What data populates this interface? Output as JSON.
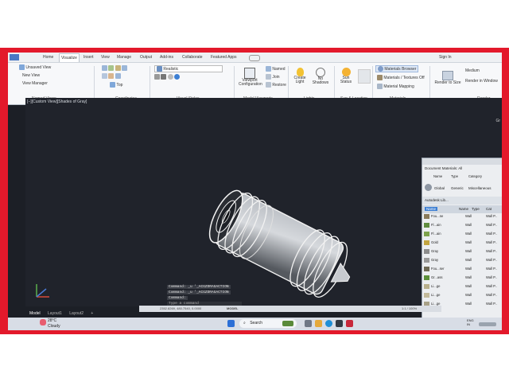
{
  "window": {
    "tabs": [
      "Home",
      "Visualize",
      "Insert",
      "View",
      "Manage",
      "Output",
      "Add-ins",
      "Collaborate",
      "Featured Apps"
    ],
    "active_tab": "Visualize"
  },
  "ribbon": {
    "named_views": {
      "unsaved_view": "Unsaved View",
      "new_view": "New View",
      "view_manager": "View Manager",
      "label": "Named Views"
    },
    "coordinates": {
      "top": "Top",
      "label": "Coordinates"
    },
    "visual_styles": {
      "current": "Realistic",
      "label": "Visual Styles"
    },
    "model_viewports": {
      "viewport_config": "Viewport Configuration",
      "named": "Named",
      "join": "Join",
      "restore": "Restore",
      "label": "Model Viewports"
    },
    "lights": {
      "create_light": "Create Light",
      "no_shadows": "No Shadows",
      "label": "Lights"
    },
    "sun_location": {
      "sun_status": "Sun Status",
      "label": "Sun & Location"
    },
    "materials": {
      "browser": "Materials Browser",
      "materials_textures": "Materials / Textures Off",
      "material_mapping": "Material Mapping",
      "label": "Materials"
    },
    "render": {
      "render_to_size": "Render to Size",
      "medium": "Medium",
      "render_in_window": "Render in Window",
      "label": "Render"
    },
    "sign_in": "Sign In"
  },
  "viewport": {
    "label": "[−][Custom View][Shades of Gray]",
    "nav_cube_label": "Gr",
    "commands": [
      "Command: _u '_ACGZDRAGACTION",
      "Command: _u '_ACGZDRAGACTION",
      "Command:"
    ],
    "command_prompt": "Type a command"
  },
  "layout_tabs": [
    "Model",
    "Layout1",
    "Layout2",
    "+"
  ],
  "status": {
    "coordinates": "2352.8269, 480.7540, 0.0000",
    "model_label": "MODEL",
    "zoom": "1:1 / 100%"
  },
  "materials_palette": {
    "title": "Document Materials: All",
    "columns": [
      "Name",
      "Type",
      "Category"
    ],
    "filters": [
      "Global",
      "Generic",
      "Miscellaneous"
    ],
    "library_label": "Autodesk Lib...",
    "list_columns": [
      "Name",
      "Type",
      "Cat"
    ],
    "items": [
      {
        "name": "Fou...ne",
        "type": "Wall",
        "category": "Wall P..",
        "color": "#8a7a5a"
      },
      {
        "name": "Fl...ain",
        "type": "Wall",
        "category": "Wall P..",
        "color": "#5f8c3f"
      },
      {
        "name": "Fl...ain",
        "type": "Wall",
        "category": "Wall P..",
        "color": "#7da24c"
      },
      {
        "name": "Gold",
        "type": "Wall",
        "category": "Wall P..",
        "color": "#c2a440"
      },
      {
        "name": "Gray",
        "type": "Wall",
        "category": "Wall P..",
        "color": "#8d8d8d"
      },
      {
        "name": "Gray",
        "type": "Wall",
        "category": "Wall P..",
        "color": "#9a9a9a"
      },
      {
        "name": "Fou...ser",
        "type": "Wall",
        "category": "Wall P..",
        "color": "#6f6a56"
      },
      {
        "name": "Gr...ass",
        "type": "Wall",
        "category": "Wall P..",
        "color": "#5c8f3a"
      },
      {
        "name": "Li...ge",
        "type": "Wall",
        "category": "Wall P..",
        "color": "#b9b08c"
      },
      {
        "name": "Li...ge",
        "type": "Wall",
        "category": "Wall P..",
        "color": "#c2b99a"
      },
      {
        "name": "Li...ge",
        "type": "Wall",
        "category": "Wall P..",
        "color": "#a8a187"
      }
    ]
  },
  "taskbar": {
    "weather_temp": "28°C",
    "weather_text": "Cloudy",
    "search_label": "Search",
    "lang": "ENG\nIN"
  },
  "colors": {
    "border_accent": "#e3192b",
    "viewport_bg": "#20232b",
    "model_stroke": "#f2f2f2"
  }
}
